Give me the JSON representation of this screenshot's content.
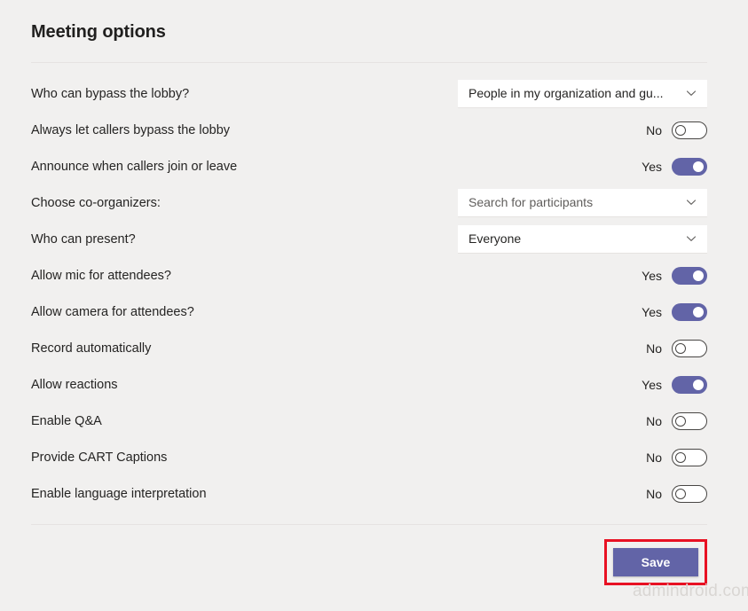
{
  "header": {
    "title": "Meeting options"
  },
  "options": [
    {
      "label": "Who can bypass the lobby?",
      "control": "dropdown",
      "value": "People in my organization and gu...",
      "is_placeholder": false
    },
    {
      "label": "Always let callers bypass the lobby",
      "control": "toggle",
      "state_label": "No",
      "on": false
    },
    {
      "label": "Announce when callers join or leave",
      "control": "toggle",
      "state_label": "Yes",
      "on": true
    },
    {
      "label": "Choose co-organizers:",
      "control": "dropdown",
      "value": "Search for participants",
      "is_placeholder": true
    },
    {
      "label": "Who can present?",
      "control": "dropdown",
      "value": "Everyone",
      "is_placeholder": false
    },
    {
      "label": "Allow mic for attendees?",
      "control": "toggle",
      "state_label": "Yes",
      "on": true
    },
    {
      "label": "Allow camera for attendees?",
      "control": "toggle",
      "state_label": "Yes",
      "on": true
    },
    {
      "label": "Record automatically",
      "control": "toggle",
      "state_label": "No",
      "on": false
    },
    {
      "label": "Allow reactions",
      "control": "toggle",
      "state_label": "Yes",
      "on": true
    },
    {
      "label": "Enable Q&A",
      "control": "toggle",
      "state_label": "No",
      "on": false
    },
    {
      "label": "Provide CART Captions",
      "control": "toggle",
      "state_label": "No",
      "on": false
    },
    {
      "label": "Enable language interpretation",
      "control": "toggle",
      "state_label": "No",
      "on": false
    }
  ],
  "footer": {
    "save_label": "Save"
  },
  "watermark": {
    "text": "admindroid.com"
  },
  "colors": {
    "accent": "#6264a7",
    "highlight": "#e81123",
    "background": "#f1f0ef",
    "divider": "#e6e3e1",
    "text": "#252423"
  },
  "icons": {
    "chevron_down": "chevron-down-icon"
  }
}
